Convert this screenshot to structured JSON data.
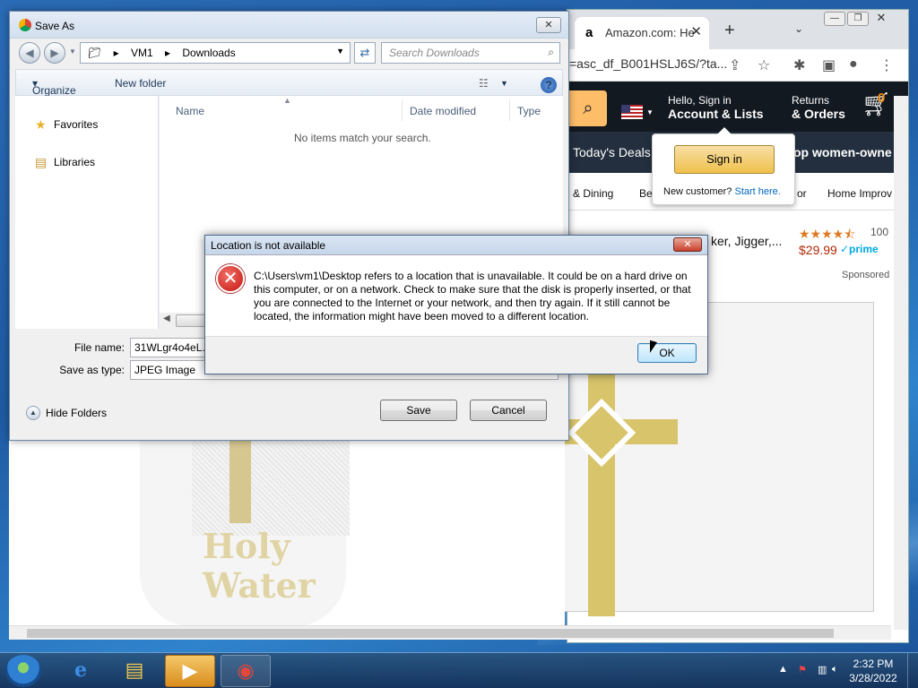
{
  "colors": {
    "amazon_nav": "#131921",
    "amazon_sub": "#232f3e",
    "amazon_search": "#febd69",
    "error_red": "#c2140d",
    "taskbar": "#1e4c80"
  },
  "chrome": {
    "tab_title": "Amazon.com: He",
    "tab_favicon": "a",
    "url": "=asc_df_B001HSLJ6S/?ta...",
    "icons": [
      "share-icon",
      "star-icon",
      "extensions-icon",
      "side-panel-icon",
      "profile-icon",
      "kebab-menu-icon"
    ]
  },
  "amazon": {
    "hello": "Hello, Sign in",
    "account": "Account & Lists",
    "returns": "Returns",
    "orders": "& Orders",
    "cart_count": "0",
    "todays_deals": "Today's Deals",
    "shop_women": "op women-owne",
    "cat_dining": "& Dining",
    "cat_be": "Be",
    "cat_or": "or",
    "cat_home": "Home Improv",
    "signin_button": "Sign in",
    "new_customer": "New customer?",
    "start_here": "Start here.",
    "product_title": "ker, Jigger,...",
    "review_count": "100",
    "price": "$29.99",
    "prime": "✓prime",
    "sponsored": "Sponsored",
    "rating": 4.5
  },
  "bottle_text": [
    "Holy",
    "Water"
  ],
  "saveas": {
    "title": "Save As",
    "path": [
      "VM1",
      "Downloads"
    ],
    "search_placeholder": "Search Downloads",
    "organize": "Organize",
    "new_folder": "New folder",
    "sidebar": [
      {
        "label": "Favorites",
        "icon": "star-icon"
      },
      {
        "label": "Libraries",
        "icon": "library-icon"
      }
    ],
    "columns": [
      "Name",
      "Date modified",
      "Type"
    ],
    "empty_text": "No items match your search.",
    "file_name_label": "File name:",
    "file_name_value": "31WLgr4o4eL._",
    "save_type_label": "Save as type:",
    "save_type_value": "JPEG Image",
    "hide_folders": "Hide Folders",
    "save_button": "Save",
    "cancel_button": "Cancel"
  },
  "error": {
    "title": "Location is not available",
    "message": "C:\\Users\\vm1\\Desktop refers to a location that is unavailable. It could be on a hard drive on this computer, or on a network. Check to make sure that the disk is properly inserted, or that you are connected to the Internet or your network, and then try again. If it still cannot be located, the information might have been moved to a different location.",
    "ok_button": "OK"
  },
  "taskbar": {
    "items": [
      {
        "name": "internet-explorer",
        "icon": "e"
      },
      {
        "name": "file-explorer",
        "icon": "▤"
      },
      {
        "name": "media-player",
        "icon": "▶"
      },
      {
        "name": "chrome",
        "icon": "◉"
      }
    ],
    "time": "2:32 PM",
    "date": "3/28/2022"
  }
}
